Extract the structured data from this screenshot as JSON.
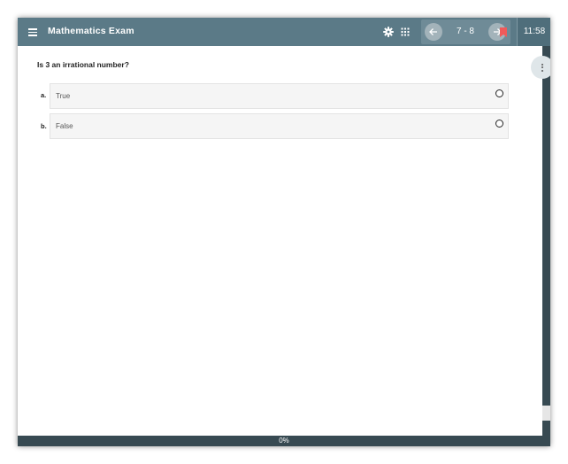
{
  "header": {
    "title": "Mathematics Exam",
    "page_range": "7 - 8",
    "timer": "11:58"
  },
  "question": {
    "text": "Is 3 an irrational number?",
    "options": [
      {
        "letter": "a.",
        "label": "True"
      },
      {
        "letter": "b.",
        "label": "False"
      }
    ]
  },
  "footer": {
    "progress": "0%"
  },
  "colors": {
    "header": "#5b7a87",
    "nav_group": "#6f8b97",
    "bookmark": "#f05a5a",
    "rail": "#374a52"
  },
  "icons": [
    "menu-icon",
    "gear-icon",
    "grid-icon",
    "arrow-left-icon",
    "arrow-right-icon",
    "bookmark-icon",
    "more-vertical-icon",
    "radio-unchecked-icon"
  ]
}
